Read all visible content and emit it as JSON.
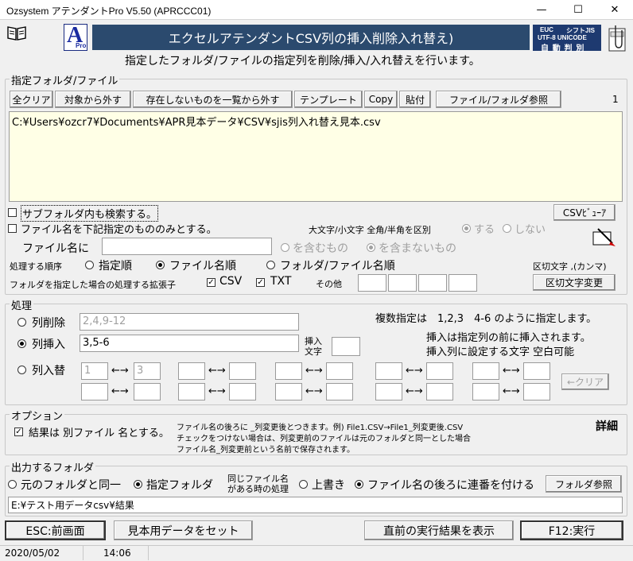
{
  "window": {
    "title": "Ozsystem アテンダントPro V5.50 (APRCCC01)",
    "minimize": "—",
    "maximize": "☐",
    "close": "✕"
  },
  "header": {
    "logo_letter": "A",
    "logo_sub": "Pro",
    "banner": "エクセルアテンダントCSV列の挿入削除入れ替え)",
    "enc_left": "EUC",
    "enc_right": "シフトJIS",
    "enc_middle": "UTF-8 UNICODE",
    "enc_auto": "自 動 判 別",
    "subtitle": "指定したフォルダ/ファイルの指定列を削除/挿入/入れ替えを行います。",
    "book_icon": "book-icon",
    "clip_icon": "clipboard-icon"
  },
  "files": {
    "group_label": "指定フォルダ/ファイル",
    "buttons": {
      "clear_all": "全クリア",
      "remove_target": "対象から外す",
      "remove_missing": "存在しないものを一覧から外す",
      "template": "テンプレート",
      "copy": "Copy",
      "paste": "貼付",
      "browse": "ファイル/フォルダ参照"
    },
    "count": "1",
    "list": [
      "C:¥Users¥ozcr7¥Documents¥APR見本データ¥CSV¥sjis列入れ替え見本.csv"
    ],
    "subfolder_label": "サブフォルダ内も検索する。",
    "csv_viewer": "CSVﾋﾞｭｰｱ",
    "filename_only_label": "ファイル名を下記指定のもののみとする。",
    "case_label": "大文字/小文字 全角/半角を区別",
    "case_yes": "する",
    "case_no": "しない",
    "filename_label": "ファイル名に",
    "filename_value": "",
    "contains": "を含むもの",
    "not_contains": "を含まないもの",
    "order_label": "処理する順序",
    "order_specified": "指定順",
    "order_filename": "ファイル名順",
    "order_folder_file": "フォルダ/ファイル名順",
    "delimiter_label": "区切文字 ,(カンマ)",
    "ext_label": "フォルダを指定した場合の処理する拡張子",
    "ext_csv": "CSV",
    "ext_txt": "TXT",
    "ext_other": "その他",
    "delimiter_button": "区切文字変更",
    "nomal_pen_icon": "pen-icon"
  },
  "process": {
    "group_label": "処理",
    "hint": "複数指定は　1,2,3　4-6 のように指定します。",
    "insert_hint1": "挿入は指定列の前に挿入されます。",
    "insert_hint2": "挿入列に設定する文字 空白可能",
    "delete_label": "列削除",
    "delete_value": "2,4,9-12",
    "insert_label": "列挿入",
    "insert_value": "3,5-6",
    "insert_char_label1": "挿入",
    "insert_char_label2": "文字",
    "insert_char_value": "",
    "swap_label": "列入替",
    "swap_from": "1",
    "swap_to": "3",
    "arrow": "←→",
    "clear_button": "←クリア"
  },
  "options": {
    "group_label": "オプション",
    "separate_label": "結果は 別ファイル 名とする。",
    "note1": "ファイル名の後ろに _列変更後とつきます。例) File1.CSV→File1_列変更後.CSV",
    "note2": "チェックをつけない場合は、列変更前のファイルは元のフォルダと同一とした場合",
    "note3": "ファイル名_列変更前という名前で保存されます。",
    "details": "詳細"
  },
  "output": {
    "group_label": "出力するフォルダ",
    "same_folder": "元のフォルダと同一",
    "specified_folder": "指定フォルダ",
    "same_name_label1": "同じファイル名",
    "same_name_label2": "がある時の処理",
    "overwrite": "上書き",
    "add_serial": "ファイル名の後ろに連番を付ける",
    "folder_browse": "フォルダ参照",
    "path": "E:¥テスト用データcsv¥結果"
  },
  "footer": {
    "back": "ESC:前画面",
    "sample": "見本用データをセット",
    "last_result": "直前の実行結果を表示",
    "execute": "F12:実行"
  },
  "status": {
    "date": "2020/05/02",
    "time": "14:06"
  }
}
